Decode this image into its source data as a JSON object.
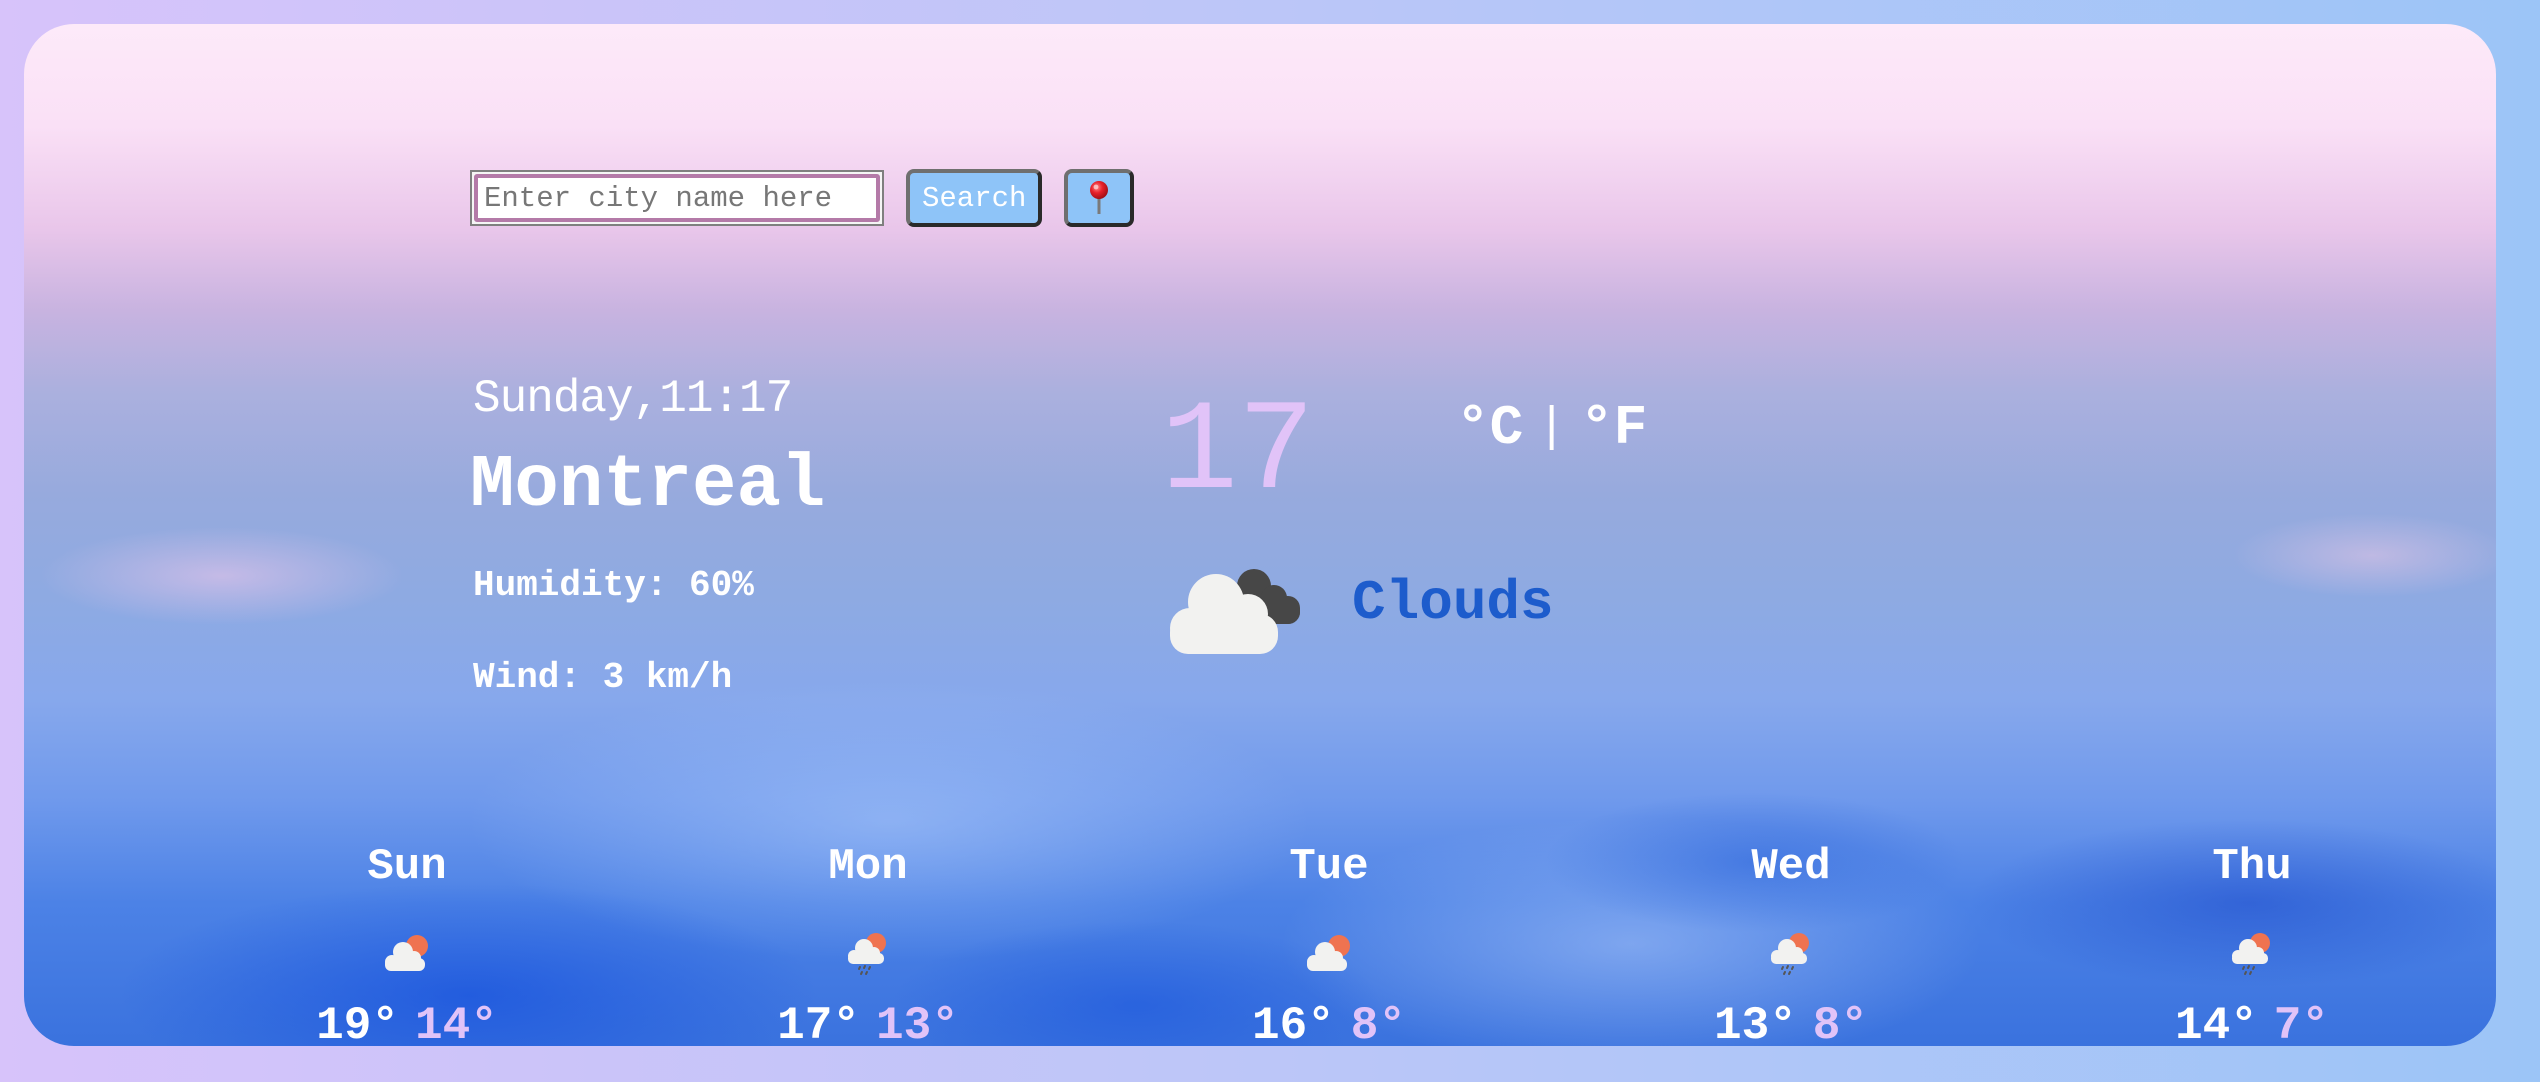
{
  "search": {
    "placeholder": "Enter city name here",
    "value": "",
    "search_label": "Search",
    "location_icon": "round-pushpin-icon"
  },
  "current": {
    "datetime": "Sunday,11:17",
    "city": "Montreal",
    "humidity_label": "Humidity: 60%",
    "humidity_value": 60,
    "wind_label": "Wind: 3 km/h",
    "wind_value": 3,
    "temperature": "17",
    "unit_celsius": "°C",
    "unit_separator": "|",
    "unit_fahrenheit": "°F",
    "description": "Clouds",
    "icon": "broken-clouds-icon"
  },
  "forecast": [
    {
      "day": "Sun",
      "icon": "partly-cloudy-day-icon",
      "max": "19°",
      "min": "14°"
    },
    {
      "day": "Mon",
      "icon": "rain-day-icon",
      "max": "17°",
      "min": "13°"
    },
    {
      "day": "Tue",
      "icon": "partly-cloudy-day-icon",
      "max": "16°",
      "min": "8°"
    },
    {
      "day": "Wed",
      "icon": "rain-day-icon",
      "max": "13°",
      "min": "8°"
    },
    {
      "day": "Thu",
      "icon": "rain-day-icon",
      "max": "14°",
      "min": "7°"
    }
  ],
  "colors": {
    "accent_temp": "#e1c3f8",
    "description": "#1d5ccc",
    "button_bg": "#8ec4f8",
    "sun": "#ef7350"
  }
}
